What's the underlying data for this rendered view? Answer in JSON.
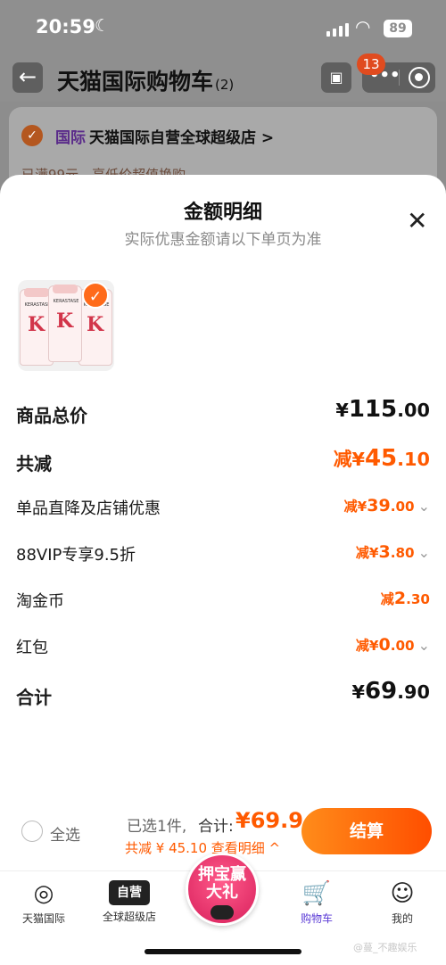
{
  "status_bar": {
    "time": "20:59",
    "battery": "89"
  },
  "header": {
    "title": "天猫国际购物车",
    "count": "(2)",
    "notification_badge": "13"
  },
  "cart_background": {
    "channel_label": "国际",
    "store_name": "天猫国际自营全球超级店 >",
    "promo_strip": "已满99元，享低价超值换购"
  },
  "sheet": {
    "title": "金额明细",
    "subtitle": "实际优惠金额请以下单页为准",
    "product": {
      "brand": "KERASTASE",
      "letter": "K"
    },
    "rows": [
      {
        "label": "商品总价",
        "prefix": "",
        "currency": "¥",
        "int": "115",
        "dec": ".00",
        "style": "big-black",
        "chevron": false
      },
      {
        "label": "共减",
        "prefix": "减",
        "currency": "¥",
        "int": "45",
        "dec": ".10",
        "style": "big-orange",
        "chevron": false
      },
      {
        "label": "单品直降及店铺优惠",
        "prefix": "减",
        "currency": "¥",
        "int": "39",
        "dec": ".00",
        "style": "orange",
        "chevron": true
      },
      {
        "label": "88VIP专享9.5折",
        "prefix": "减",
        "currency": "¥",
        "int": "3",
        "dec": ".80",
        "style": "orange",
        "chevron": true
      },
      {
        "label": "淘金币",
        "prefix": "减",
        "currency": "",
        "int": "2",
        "dec": ".30",
        "style": "orange",
        "chevron": false
      },
      {
        "label": "红包",
        "prefix": "减",
        "currency": "¥",
        "int": "0",
        "dec": ".00",
        "style": "orange",
        "chevron": true
      },
      {
        "label": "合计",
        "prefix": "",
        "currency": "¥",
        "int": "69",
        "dec": ".90",
        "style": "big-black",
        "chevron": false
      }
    ]
  },
  "footer": {
    "select_all": "全选",
    "selected_info": "已选1件,",
    "total_label": "合计:",
    "total_value": "¥69.9",
    "discount_line": "共减 ¥ 45.10 查看明细 ^",
    "checkout": "结算"
  },
  "tabbar": {
    "tabs": [
      {
        "label": "天猫国际"
      },
      {
        "label": "全球超级店",
        "icon_text": "自营"
      },
      {
        "label": "购物车"
      },
      {
        "label": "我的"
      }
    ],
    "promo_text": "押宝赢大礼"
  },
  "watermark": "@蔓_不趣娱乐",
  "colors": {
    "accent": "#ff5a00",
    "active_tab": "#5b3bd6",
    "checkout_start": "#ff8c1a",
    "checkout_end": "#ff4e00"
  }
}
